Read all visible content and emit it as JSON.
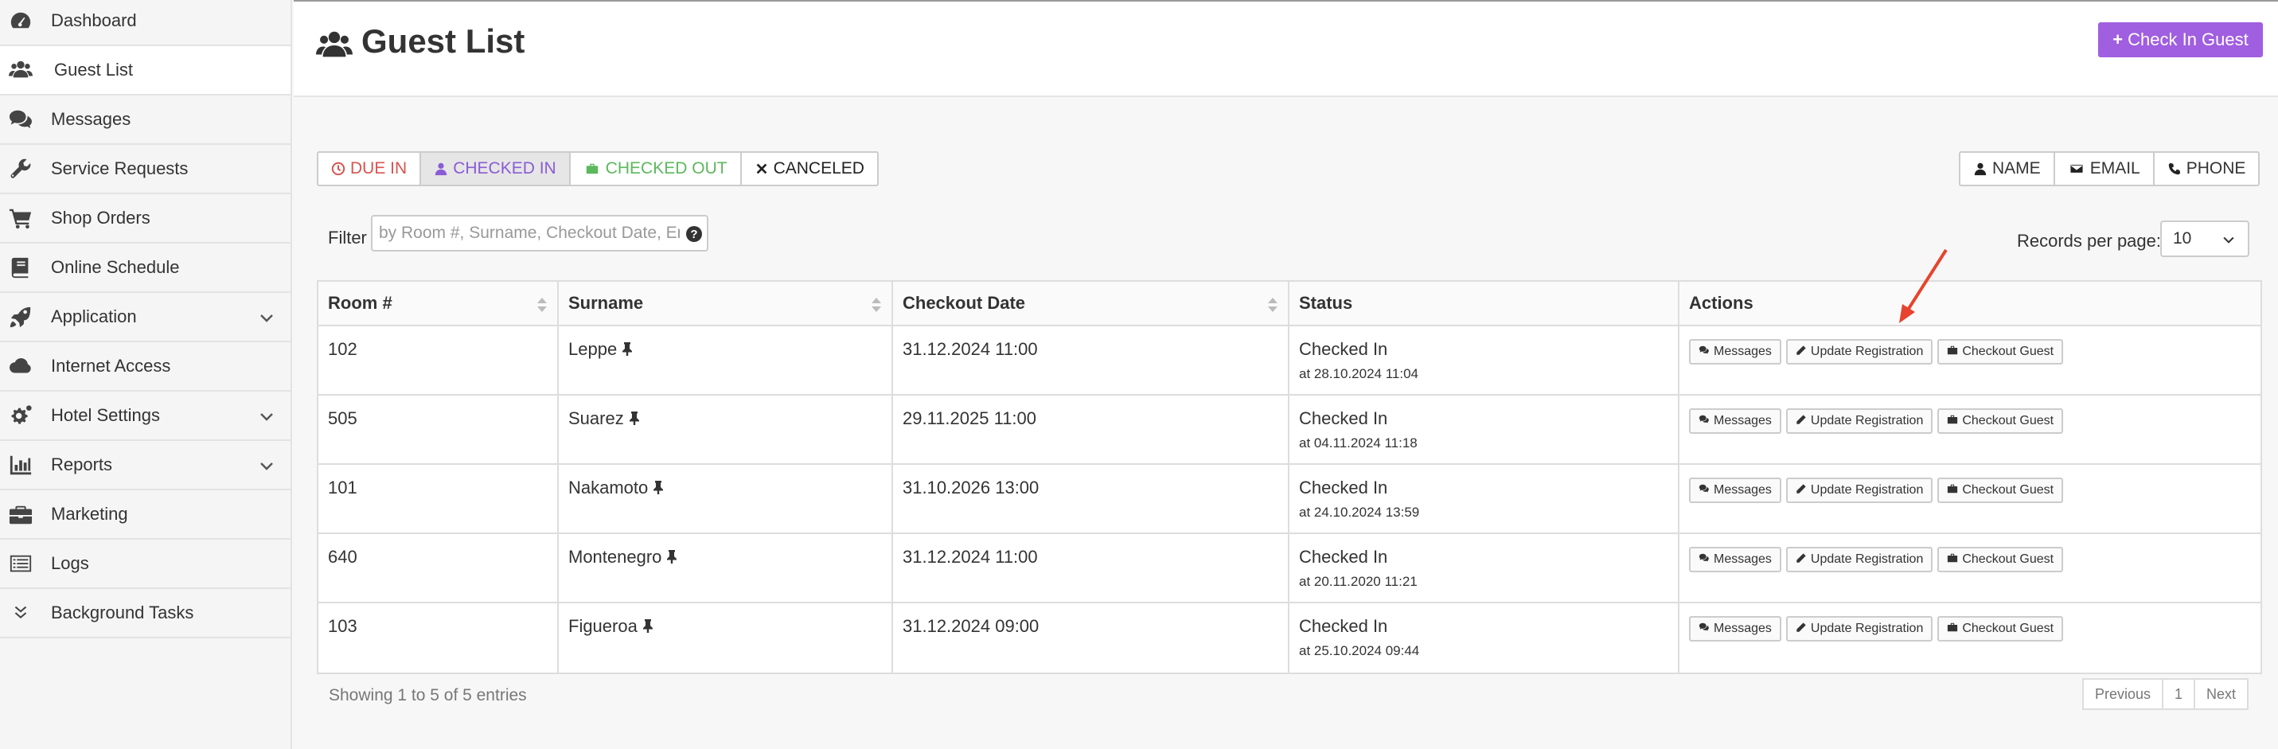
{
  "sidebar": {
    "items": [
      {
        "label": "Dashboard",
        "icon": "dashboard-icon"
      },
      {
        "label": "Guest List",
        "icon": "users-icon",
        "active": true
      },
      {
        "label": "Messages",
        "icon": "comments-icon"
      },
      {
        "label": "Service Requests",
        "icon": "wrench-icon"
      },
      {
        "label": "Shop Orders",
        "icon": "cart-icon"
      },
      {
        "label": "Online Schedule",
        "icon": "book-icon"
      },
      {
        "label": "Application",
        "icon": "rocket-icon",
        "expandable": true
      },
      {
        "label": "Internet Access",
        "icon": "cloud-icon"
      },
      {
        "label": "Hotel Settings",
        "icon": "gears-icon",
        "expandable": true
      },
      {
        "label": "Reports",
        "icon": "bar-chart-icon",
        "expandable": true
      },
      {
        "label": "Marketing",
        "icon": "briefcase-icon"
      },
      {
        "label": "Logs",
        "icon": "list-icon"
      },
      {
        "label": "Background Tasks",
        "icon": "double-chevron-down-icon"
      }
    ]
  },
  "header": {
    "title": "Guest List",
    "check_in_button": "Check In Guest"
  },
  "tabs": {
    "due_in": "DUE IN",
    "checked_in": "CHECKED IN",
    "checked_out": "CHECKED OUT",
    "canceled": "CANCELED"
  },
  "sort_buttons": {
    "name": "NAME",
    "email": "EMAIL",
    "phone": "PHONE"
  },
  "filter": {
    "label": "Filter",
    "placeholder": "by Room #, Surname, Checkout Date, Email"
  },
  "records_per_page": {
    "label": "Records per page:",
    "value": "10"
  },
  "table": {
    "headers": [
      "Room #",
      "Surname",
      "Checkout Date",
      "Status",
      "Actions"
    ],
    "rows": [
      {
        "room": "102",
        "surname": "Leppe",
        "checkout": "31.12.2024 11:00",
        "status": "Checked In",
        "status_sub": "at 28.10.2024 11:04"
      },
      {
        "room": "505",
        "surname": "Suarez",
        "checkout": "29.11.2025 11:00",
        "status": "Checked In",
        "status_sub": "at 04.11.2024 11:18"
      },
      {
        "room": "101",
        "surname": "Nakamoto",
        "checkout": "31.10.2026 13:00",
        "status": "Checked In",
        "status_sub": "at 24.10.2024 13:59"
      },
      {
        "room": "640",
        "surname": "Montenegro",
        "checkout": "31.12.2024 11:00",
        "status": "Checked In",
        "status_sub": "at 20.11.2020 11:21"
      },
      {
        "room": "103",
        "surname": "Figueroa",
        "checkout": "31.12.2024 09:00",
        "status": "Checked In",
        "status_sub": "at 25.10.2024 09:44"
      }
    ],
    "actions": {
      "messages": "Messages",
      "update": "Update Registration",
      "checkout": "Checkout Guest"
    }
  },
  "footer": {
    "showing": "Showing 1 to 5 of 5 entries",
    "previous": "Previous",
    "page": "1",
    "next": "Next"
  },
  "colors": {
    "accent": "#a05ee0",
    "due_in": "#d9534f",
    "checked_in": "#8a5cd6",
    "checked_out": "#5cb85c",
    "arrow": "#e8432e"
  }
}
